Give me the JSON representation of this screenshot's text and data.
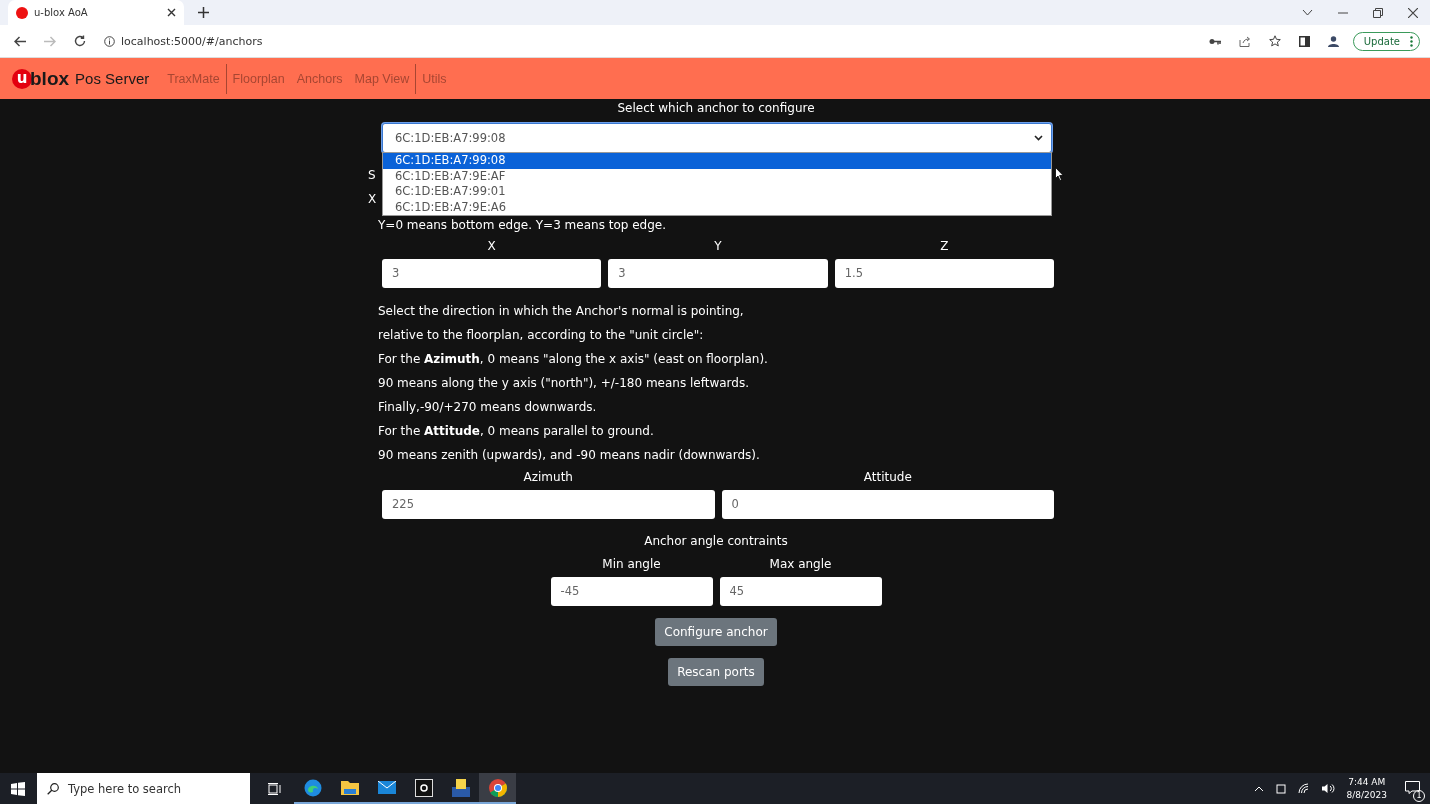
{
  "browser": {
    "tab_title": "u-blox AoA",
    "url": "localhost:5000/#/anchors",
    "update_button": "Update"
  },
  "nav": {
    "logo_mark": "u",
    "logo_text": "blox",
    "app_name": "Pos Server",
    "links": [
      {
        "label": "TraxMate",
        "divider_after": true
      },
      {
        "label": "Floorplan",
        "divider_after": false
      },
      {
        "label": "Anchors",
        "divider_after": false
      },
      {
        "label": "Map View",
        "divider_after": true
      },
      {
        "label": "Utils",
        "divider_after": false
      }
    ]
  },
  "anchor_select": {
    "label": "Select which anchor to configure",
    "value": "6C:1D:EB:A7:99:08",
    "options": [
      {
        "label": "6C:1D:EB:A7:99:08",
        "selected": true
      },
      {
        "label": "6C:1D:EB:A7:9E:AF",
        "selected": false
      },
      {
        "label": "6C:1D:EB:A7:99:01",
        "selected": false
      },
      {
        "label": "6C:1D:EB:A7:9E:A6",
        "selected": false
      }
    ]
  },
  "hidden_lines": [
    "S",
    "X",
    "Y=0 means bottom edge. Y=3 means top edge."
  ],
  "position_fields": [
    {
      "label": "X",
      "value": "3"
    },
    {
      "label": "Y",
      "value": "3"
    },
    {
      "label": "Z",
      "value": "1.5"
    }
  ],
  "instructions": [
    "Select the direction in which the Anchor's normal is pointing,",
    "relative to the floorplan, according to the \"unit circle\":",
    "For the **Azimuth**, 0 means \"along the x axis\" (east on floorplan).",
    "90 means along the y axis (\"north\"), +/-180 means leftwards.",
    "Finally,-90/+270 means downwards.",
    "For the **Attitude**, 0 means parallel to ground.",
    "90 means zenith (upwards), and -90 means nadir (downwards)."
  ],
  "orientation_fields": [
    {
      "label": "Azimuth",
      "value": "225"
    },
    {
      "label": "Attitude",
      "value": "0"
    }
  ],
  "constraints_title": "Anchor angle contraints",
  "angle_fields": [
    {
      "label": "Min angle",
      "value": "-45"
    },
    {
      "label": "Max angle",
      "value": "45"
    }
  ],
  "buttons": [
    "Configure anchor",
    "Rescan ports"
  ],
  "taskbar": {
    "search_placeholder": "Type here to search",
    "time": "7:44 AM",
    "date": "8/8/2023",
    "notification_count": "1"
  }
}
